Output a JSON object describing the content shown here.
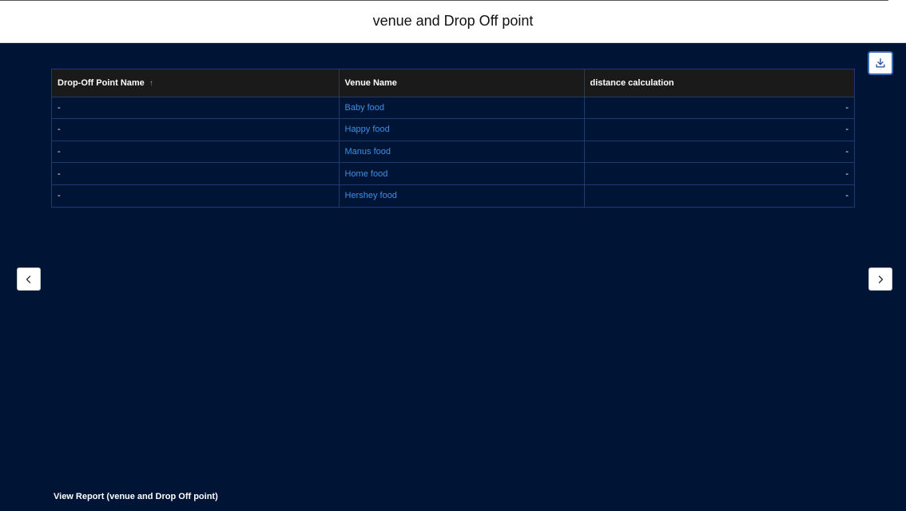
{
  "header": {
    "title": "venue and Drop Off point"
  },
  "toolbar": {
    "download_icon": "download-icon"
  },
  "table": {
    "columns": [
      {
        "label": "Drop-Off Point Name",
        "sort": "ascending",
        "sort_icon": "↑"
      },
      {
        "label": "Venue Name"
      },
      {
        "label": "distance calculation"
      }
    ],
    "rows": [
      {
        "dropoff": "-",
        "venue": "Baby food",
        "distance": "-"
      },
      {
        "dropoff": "-",
        "venue": "Happy food",
        "distance": "-"
      },
      {
        "dropoff": "-",
        "venue": "Manus food",
        "distance": "-"
      },
      {
        "dropoff": "-",
        "venue": "Home food",
        "distance": "-"
      },
      {
        "dropoff": "-",
        "venue": "Hershey food",
        "distance": "-"
      }
    ]
  },
  "navigation": {
    "prev_icon": "chevron-left-icon",
    "next_icon": "chevron-right-icon"
  },
  "footer": {
    "label": "View Report (venue and Drop Off point)"
  },
  "colors": {
    "background": "#001435",
    "header_background": "#ffffff",
    "table_header_background": "#1a1a1a",
    "link": "#3d8fe8",
    "border": "#1e3a72"
  }
}
